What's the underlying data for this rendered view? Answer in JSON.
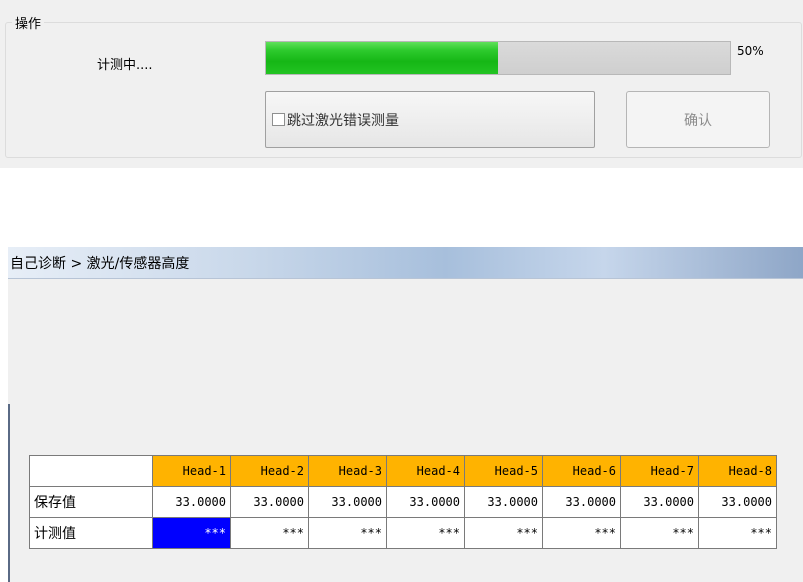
{
  "operation": {
    "group_title": "操作",
    "status_label": "计测中....",
    "progress": {
      "value": 0.5,
      "text": "50%"
    },
    "skip_button_label": "跳过激光错误测量",
    "confirm_button_label": "确认"
  },
  "diagnosis": {
    "breadcrumb": "自己诊断 > 激光/传感器高度",
    "table": {
      "columns": [
        "Head-1",
        "Head-2",
        "Head-3",
        "Head-4",
        "Head-5",
        "Head-6",
        "Head-7",
        "Head-8"
      ],
      "rows": [
        {
          "label": "保存值",
          "values": [
            "33.0000",
            "33.0000",
            "33.0000",
            "33.0000",
            "33.0000",
            "33.0000",
            "33.0000",
            "33.0000"
          ]
        },
        {
          "label": "计测值",
          "values": [
            "***",
            "***",
            "***",
            "***",
            "***",
            "***",
            "***",
            "***"
          ]
        }
      ]
    }
  },
  "colors": {
    "header_cell": "#ffb300",
    "selected_cell": "#0000ff",
    "progress_fill": "#16b716"
  }
}
